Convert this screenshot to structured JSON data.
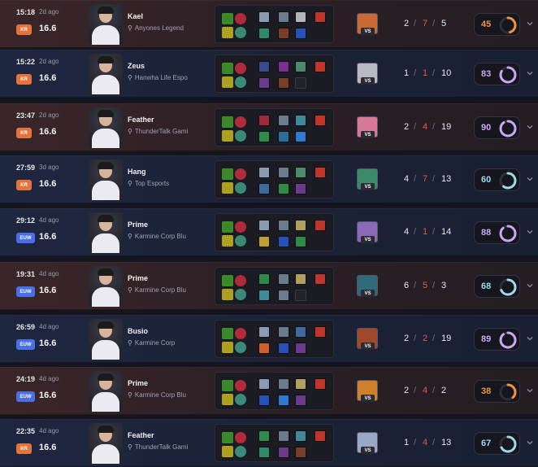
{
  "matches": [
    {
      "duration": "15:18",
      "ago": "2d ago",
      "region": "KR",
      "patch": "16.6",
      "player": "Kael",
      "team": "Anyones Legend",
      "result": "loss",
      "kda": {
        "k": "2",
        "d": "7",
        "a": "5"
      },
      "score": "45",
      "score_color": "#f5923e",
      "score_fraction": 0.45,
      "vs_label": "VS",
      "champ_color": "#c96a34",
      "items": [
        "#8a9bb3",
        "#6b7b8c",
        "#b0b5bd",
        "#c0362c",
        "#2c8a6a",
        "#7a3e26",
        "#2750b8"
      ]
    },
    {
      "duration": "15:22",
      "ago": "2d ago",
      "region": "KR",
      "patch": "16.6",
      "player": "Zeus",
      "team": "Hanwha Life Espo",
      "result": "win",
      "kda": {
        "k": "1",
        "d": "1",
        "a": "10"
      },
      "score": "83",
      "score_color": "#c9a8f0",
      "score_fraction": 0.83,
      "vs_label": "VS",
      "champ_color": "#b9b9c4",
      "items": [
        "#3b4a8f",
        "#7a2e96",
        "#4b8a6b",
        "#c0362c",
        "#6a3b8a",
        "#7a3e26",
        ""
      ]
    },
    {
      "duration": "23:47",
      "ago": "2d ago",
      "region": "KR",
      "patch": "16.6",
      "player": "Feather",
      "team": "ThunderTalk Gami",
      "result": "loss",
      "kda": {
        "k": "2",
        "d": "4",
        "a": "19"
      },
      "score": "90",
      "score_color": "#c9a8f0",
      "score_fraction": 0.9,
      "vs_label": "VS",
      "champ_color": "#d8799a",
      "items": [
        "#a02a3a",
        "#6b7b8c",
        "#3e8a9a",
        "#c0362c",
        "#2e8a4a",
        "#2a6f9a",
        "#2e7ad0"
      ]
    },
    {
      "duration": "27:59",
      "ago": "3d ago",
      "region": "KR",
      "patch": "16.6",
      "player": "Hang",
      "team": "Top Esports",
      "result": "win",
      "kda": {
        "k": "4",
        "d": "7",
        "a": "13"
      },
      "score": "60",
      "score_color": "#9ed8ea",
      "score_fraction": 0.6,
      "vs_label": "VS",
      "champ_color": "#3c8a6a",
      "items": [
        "#8a9bb3",
        "#6b7b8c",
        "#4b8a6b",
        "#c0362c",
        "#3e6aa0",
        "#2e8a4a",
        "#6a3b8a"
      ]
    },
    {
      "duration": "29:12",
      "ago": "4d ago",
      "region": "EUW",
      "patch": "16.6",
      "player": "Prime",
      "team": "Karmine Corp Blu",
      "result": "win",
      "kda": {
        "k": "4",
        "d": "1",
        "a": "14"
      },
      "score": "88",
      "score_color": "#c9a8f0",
      "score_fraction": 0.88,
      "vs_label": "VS",
      "champ_color": "#8a6ab8",
      "items": [
        "#8a9bb3",
        "#6b7b8c",
        "#b0a060",
        "#c0362c",
        "#c0a030",
        "#2750b8",
        "#2e8a4a"
      ]
    },
    {
      "duration": "19:31",
      "ago": "4d ago",
      "region": "EUW",
      "patch": "16.6",
      "player": "Prime",
      "team": "Karmine Corp Blu",
      "result": "loss",
      "kda": {
        "k": "6",
        "d": "5",
        "a": "3"
      },
      "score": "68",
      "score_color": "#9ed8ea",
      "score_fraction": 0.68,
      "vs_label": "VS",
      "champ_color": "#2e6a7a",
      "items": [
        "#2e8a4a",
        "#6b7b8c",
        "#b0a060",
        "#c0362c",
        "#3e8a9a",
        "#6b7b8c",
        ""
      ]
    },
    {
      "duration": "26:59",
      "ago": "4d ago",
      "region": "EUW",
      "patch": "16.6",
      "player": "Busio",
      "team": "Karmine Corp",
      "result": "win",
      "kda": {
        "k": "2",
        "d": "2",
        "a": "19"
      },
      "score": "89",
      "score_color": "#c9a8f0",
      "score_fraction": 0.89,
      "vs_label": "VS",
      "champ_color": "#a0482a",
      "items": [
        "#8a9bb3",
        "#6b7b8c",
        "#3e6aa0",
        "#c0362c",
        "#d0602a",
        "#2750b8",
        "#6a3b8a"
      ]
    },
    {
      "duration": "24:19",
      "ago": "4d ago",
      "region": "EUW",
      "patch": "16.6",
      "player": "Prime",
      "team": "Karmine Corp Blu",
      "result": "loss",
      "kda": {
        "k": "2",
        "d": "4",
        "a": "2"
      },
      "score": "38",
      "score_color": "#f5923e",
      "score_fraction": 0.38,
      "vs_label": "VS",
      "champ_color": "#d0802a",
      "items": [
        "#8a9bb3",
        "#6b7b8c",
        "#b0a060",
        "#c0362c",
        "#2750b8",
        "#2e7ad0",
        "#6a3b8a"
      ]
    },
    {
      "duration": "22:35",
      "ago": "4d ago",
      "region": "KR",
      "patch": "16.6",
      "player": "Feather",
      "team": "ThunderTalk Gami",
      "result": "win",
      "kda": {
        "k": "1",
        "d": "4",
        "a": "13"
      },
      "score": "67",
      "score_color": "#9ed8ea",
      "score_fraction": 0.67,
      "vs_label": "VS",
      "champ_color": "#9aa8c8",
      "items": [
        "#2e8a4a",
        "#6b7b8c",
        "#3e8a9a",
        "#c0362c",
        "#2e8a6a",
        "#6a3b8a",
        "#7a3e26"
      ]
    }
  ]
}
